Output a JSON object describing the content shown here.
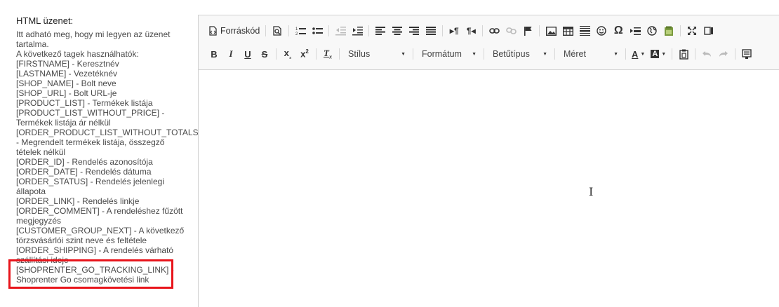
{
  "panel": {
    "title": "HTML üzenet:",
    "help_lines": [
      "Itt adható meg, hogy mi legyen az üzenet",
      "tartalma.",
      "A következő tagek használhatók:",
      "[FIRSTNAME] - Keresztnév",
      "[LASTNAME] - Vezetéknév",
      "[SHOP_NAME] - Bolt neve",
      "[SHOP_URL] - Bolt URL-je",
      "[PRODUCT_LIST] - Termékek listája",
      "[PRODUCT_LIST_WITHOUT_PRICE] -",
      "Termékek listája ár nélkül",
      "[ORDER_PRODUCT_LIST_WITHOUT_TOTALS]",
      "- Megrendelt termékek listája, összegző",
      "tételek nélkül",
      "[ORDER_ID] - Rendelés azonosítója",
      "[ORDER_DATE] - Rendelés dátuma",
      "[ORDER_STATUS] - Rendelés jelenlegi",
      "állapota",
      "[ORDER_LINK] - Rendelés linkje",
      "[ORDER_COMMENT] - A rendeléshez fűzött",
      "megjegyzés",
      "[CUSTOMER_GROUP_NEXT] - A következő",
      "törzsvásárlói szint neve és feltétele",
      "[ORDER_SHIPPING] - A rendelés várható",
      "szállítási ideje",
      "[SHOPRENTER_GO_TRACKING_LINK] -",
      "Shoprenter Go csomagkövetési link"
    ]
  },
  "toolbar": {
    "source_label": "Forráskód",
    "style_label": "Stílus",
    "format_label": "Formátum",
    "font_label": "Betűtípus",
    "size_label": "Méret"
  },
  "colors": {
    "highlight": "#e8141b",
    "toolbar_bg": "#f8f8f8",
    "border": "#d1d1d1"
  }
}
